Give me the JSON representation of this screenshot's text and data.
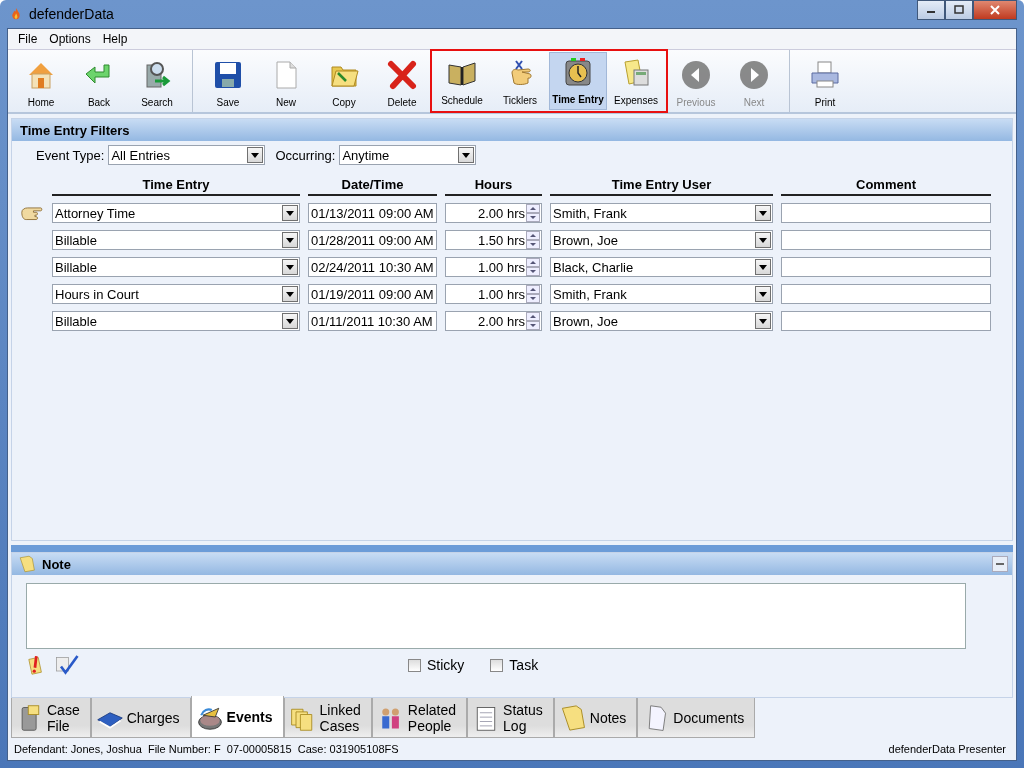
{
  "window": {
    "title": "defenderData"
  },
  "menu": [
    "File",
    "Options",
    "Help"
  ],
  "toolbar": {
    "sections": [
      {
        "divider": false,
        "outlined": false,
        "buttons": [
          {
            "label": "Home",
            "selected": false,
            "disabled": false
          },
          {
            "label": "Back",
            "selected": false,
            "disabled": false
          },
          {
            "label": "Search",
            "selected": false,
            "disabled": false
          }
        ]
      },
      {
        "divider": true,
        "outlined": false,
        "buttons": [
          {
            "label": "Save",
            "selected": false,
            "disabled": false
          },
          {
            "label": "New",
            "selected": false,
            "disabled": false
          },
          {
            "label": "Copy",
            "selected": false,
            "disabled": false
          },
          {
            "label": "Delete",
            "selected": false,
            "disabled": false
          }
        ]
      },
      {
        "divider": false,
        "outlined": true,
        "buttons": [
          {
            "label": "Schedule",
            "selected": false,
            "disabled": false
          },
          {
            "label": "Ticklers",
            "selected": false,
            "disabled": false
          },
          {
            "label": "Time Entry",
            "selected": true,
            "disabled": false
          },
          {
            "label": "Expenses",
            "selected": false,
            "disabled": false
          }
        ]
      },
      {
        "divider": false,
        "outlined": false,
        "buttons": [
          {
            "label": "Previous",
            "selected": false,
            "disabled": true
          },
          {
            "label": "Next",
            "selected": false,
            "disabled": true
          }
        ]
      },
      {
        "divider": true,
        "outlined": false,
        "buttons": [
          {
            "label": "Print",
            "selected": false,
            "disabled": false
          }
        ]
      }
    ]
  },
  "filters": {
    "title": "Time Entry Filters",
    "event_type": {
      "label": "Event Type:",
      "value": "All Entries"
    },
    "occurring": {
      "label": "Occurring:",
      "value": "Anytime"
    }
  },
  "table": {
    "columns": [
      "Time Entry",
      "Date/Time",
      "Hours",
      "Time Entry User",
      "Comment"
    ],
    "rows": [
      {
        "current": true,
        "entry": "Attorney Time",
        "datetime": "01/13/2011 09:00 AM",
        "hours": "2.00 hrs",
        "user": "Smith, Frank"
      },
      {
        "current": false,
        "entry": "Billable",
        "datetime": "01/28/2011 09:00 AM",
        "hours": "1.50 hrs",
        "user": "Brown, Joe"
      },
      {
        "current": false,
        "entry": "Billable",
        "datetime": "02/24/2011 10:30 AM",
        "hours": "1.00 hrs",
        "user": "Black, Charlie"
      },
      {
        "current": false,
        "entry": "Hours in Court",
        "datetime": "01/19/2011 09:00 AM",
        "hours": "1.00 hrs",
        "user": "Smith, Frank"
      },
      {
        "current": false,
        "entry": "Billable",
        "datetime": "01/11/2011 10:30 AM",
        "hours": "2.00 hrs",
        "user": "Brown, Joe"
      }
    ]
  },
  "note": {
    "title": "Note",
    "checkboxes": [
      {
        "label": "Sticky",
        "checked": false
      },
      {
        "label": "Task",
        "checked": false
      }
    ]
  },
  "tabs": [
    {
      "label": "Case\nFile",
      "selected": false
    },
    {
      "label": "Charges",
      "selected": false
    },
    {
      "label": "Events",
      "selected": true
    },
    {
      "label": "Linked\nCases",
      "selected": false
    },
    {
      "label": "Related\nPeople",
      "selected": false
    },
    {
      "label": "Status\nLog",
      "selected": false
    },
    {
      "label": "Notes",
      "selected": false
    },
    {
      "label": "Documents",
      "selected": false
    }
  ],
  "status_bar": {
    "left": "Defendant: Jones, Joshua  File Number: F  07-00005815  Case: 031905108FS",
    "right": "defenderData Presenter"
  }
}
